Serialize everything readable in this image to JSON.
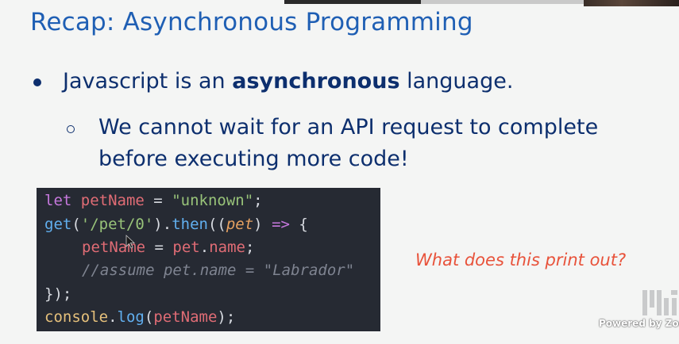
{
  "slide": {
    "title": "Recap: Asynchronous Programming",
    "bullet1": {
      "pre": "Javascript is an ",
      "bold": "asynchronous",
      "post": " language."
    },
    "bullet2": {
      "line1": "We cannot wait for an API request to complete",
      "line2": "before executing more code!"
    },
    "question": "What does this print out?"
  },
  "code": {
    "line1": {
      "kw": "let",
      "var": "petName",
      "eq": " = ",
      "str": "\"unknown\"",
      "end": ";"
    },
    "line2": {
      "fn1": "get",
      "p1": "(",
      "str": "'/pet/0'",
      "p2": ").",
      "fn2": "then",
      "p3": "((",
      "param": "pet",
      "p4": ") ",
      "arrow": "=>",
      "p5": " {"
    },
    "line3": {
      "var1": "petName",
      "eq": " = ",
      "var2": "pet",
      "dot": ".",
      "var3": "name",
      "end": ";"
    },
    "line4": "//assume pet.name = \"Labrador\"",
    "line5": "});",
    "line6": {
      "var1": "console",
      "dot": ".",
      "fn": "log",
      "p1": "(",
      "var2": "petName",
      "p2": ");"
    }
  },
  "watermark": {
    "powered_by": "Powered by Zoom",
    "logo": "MIT"
  },
  "colors": {
    "title": "#1f5fb4",
    "body": "#0d2f6e",
    "question": "#e8523a",
    "code_bg": "#262a33"
  }
}
